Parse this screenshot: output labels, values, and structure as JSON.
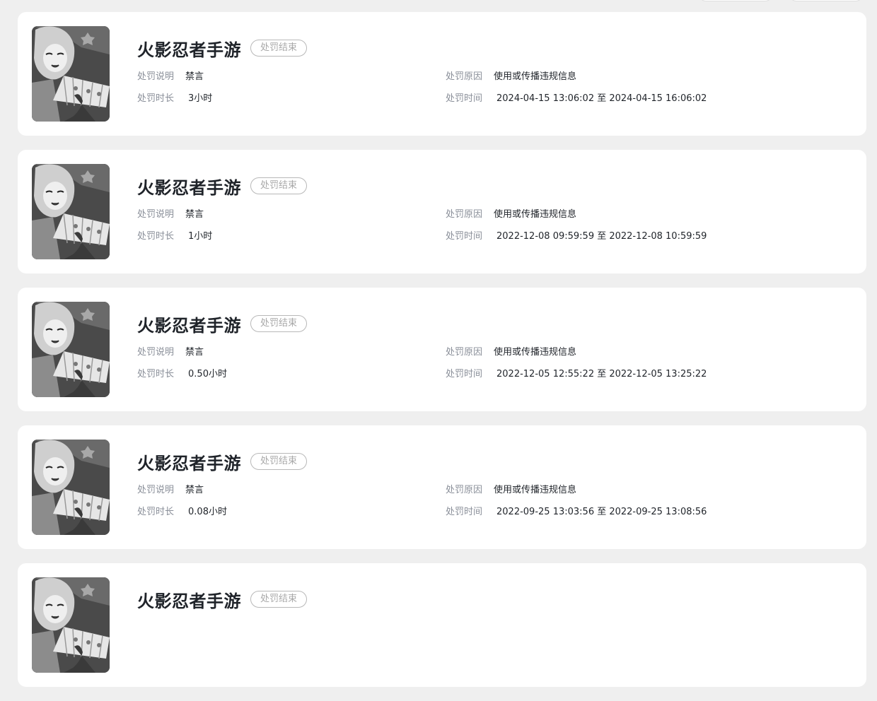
{
  "records": [
    {
      "game": "火影忍者手游",
      "status": "处罚结束",
      "desc_label": "处罚说明",
      "desc_value": "禁言",
      "duration_label": "处罚时长",
      "duration_value": "3小时",
      "reason_label": "处罚原因",
      "reason_value": "使用或传播违规信息",
      "time_label": "处罚时间",
      "time_value": "2024-04-15 13:06:02 至 2024-04-15 16:06:02"
    },
    {
      "game": "火影忍者手游",
      "status": "处罚结束",
      "desc_label": "处罚说明",
      "desc_value": "禁言",
      "duration_label": "处罚时长",
      "duration_value": "1小时",
      "reason_label": "处罚原因",
      "reason_value": "使用或传播违规信息",
      "time_label": "处罚时间",
      "time_value": "2022-12-08 09:59:59 至 2022-12-08 10:59:59"
    },
    {
      "game": "火影忍者手游",
      "status": "处罚结束",
      "desc_label": "处罚说明",
      "desc_value": "禁言",
      "duration_label": "处罚时长",
      "duration_value": "0.50小时",
      "reason_label": "处罚原因",
      "reason_value": "使用或传播违规信息",
      "time_label": "处罚时间",
      "time_value": "2022-12-05 12:55:22 至 2022-12-05 13:25:22"
    },
    {
      "game": "火影忍者手游",
      "status": "处罚结束",
      "desc_label": "处罚说明",
      "desc_value": "禁言",
      "duration_label": "处罚时长",
      "duration_value": "0.08小时",
      "reason_label": "处罚原因",
      "reason_value": "使用或传播违规信息",
      "time_label": "处罚时间",
      "time_value": "2022-09-25 13:03:56 至 2022-09-25 13:08:56"
    },
    {
      "game": "火影忍者手游",
      "status": "处罚结束"
    }
  ],
  "colors": {
    "page_bg": "#efefef",
    "card_bg": "#ffffff",
    "title": "#1f2329",
    "label": "#8a8f99",
    "badge_text": "#a8a8a8",
    "badge_border": "#b8b8b8"
  },
  "icons": {
    "avatar": "game-avatar-icon"
  }
}
